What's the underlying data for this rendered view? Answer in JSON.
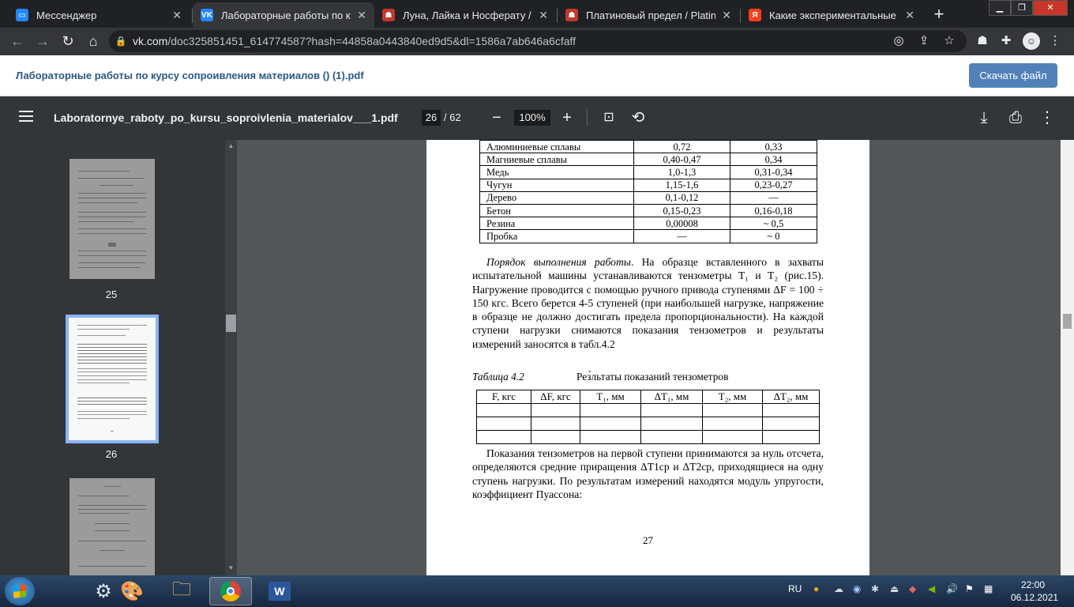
{
  "browser": {
    "tabs": [
      {
        "title": "Мессенджер",
        "icon": "messenger-icon",
        "active": false
      },
      {
        "title": "Лабораторные работы по курс",
        "icon": "vk-icon",
        "active": true
      },
      {
        "title": "Луна, Лайка и Носферату / Tsu",
        "icon": "shikimori-icon",
        "active": false
      },
      {
        "title": "Платиновый предел / Platinum",
        "icon": "shikimori-icon",
        "active": false
      },
      {
        "title": "Какие экспериментальные да",
        "icon": "yandex-icon",
        "active": false
      }
    ],
    "new_tab_label": "+",
    "url_host": "vk.com",
    "url_path": "/doc325851451_614774587?hash=44858a0443840ed9d5&dl=1586a7ab646a6cfaff"
  },
  "vk": {
    "doc_title": "Лабораторные работы по курсу сопроивления материалов () (1).pdf",
    "download_button": "Скачать файл"
  },
  "pdf_viewer": {
    "file_name": "Laboratornye_raboty_po_kursu_soproivlenia_materialov___1.pdf",
    "current_page": "26",
    "total_pages": "/ 62",
    "zoom": "100%",
    "thumbnails": [
      {
        "label": "25",
        "selected": false
      },
      {
        "label": "26",
        "selected": true
      }
    ]
  },
  "page": {
    "materials_table": [
      [
        "Алюминиевые сплавы",
        "0,72",
        "0,33"
      ],
      [
        "Магниевые сплавы",
        "0,40-0,47",
        "0,34"
      ],
      [
        "Медь",
        "1,0-1,3",
        "0,31-0,34"
      ],
      [
        "Чугун",
        "1,15-1,6",
        "0,23-0,27"
      ],
      [
        "Дерево",
        "0,1-0,12",
        "—"
      ],
      [
        "Бетон",
        "0,15-0,23",
        "0,16-0,18"
      ],
      [
        "Резина",
        "0,00008",
        "~ 0,5"
      ],
      [
        "Пробка",
        "—",
        "~ 0"
      ]
    ],
    "procedure_title": "Порядок выполнения работы",
    "procedure_text": ". На образце вставленного в захваты испытательной машины устанавливаются тензометры T₁ и T₂ (рис.15). Нагружение проводится с помощью ручного привода ступенями ΔF = 100 ÷ 150 кгс. Всего берется 4-5 ступеней (при наибольшей нагрузке, напряжение в образце не должно достигать предела пропорциональности). На каждой ступени нагрузки снимаются показания тензометров и результаты измерений заносятся в табл.4.2",
    "table_caption": "Таблица 4.2",
    "table_name": "Рез́льтаты показаний тензометров",
    "results_headers": [
      "F, кгс",
      "ΔF, кгс",
      "T₁, мм",
      "ΔT₁, мм",
      "T₂, мм",
      "ΔT₂, мм"
    ],
    "results_empty_rows": 3,
    "final_text": "Показания тензометров на первой ступени принимаются за нуль отсчета, определяются средние приращения ΔT1ср и ΔT2ср, приходящиеся на одну ступень нагрузки. По результатам измерений находятся модуль упругости, коэффициент Пуассона:",
    "page_number": "27"
  },
  "taskbar": {
    "apps": [
      "steam-icon",
      "paint-icon",
      "explorer-icon",
      "chrome-icon",
      "word-icon"
    ],
    "language": "RU",
    "time": "22:00",
    "date": "06.12.2021"
  },
  "colors": {
    "chrome_dark": "#202124",
    "toolbar": "#35363a",
    "vk_link": "#2a5885",
    "vk_button": "#5181b8",
    "pdf_bar": "#323639",
    "doc_bg": "#525659",
    "thumb_selected": "#8ab4f8"
  }
}
